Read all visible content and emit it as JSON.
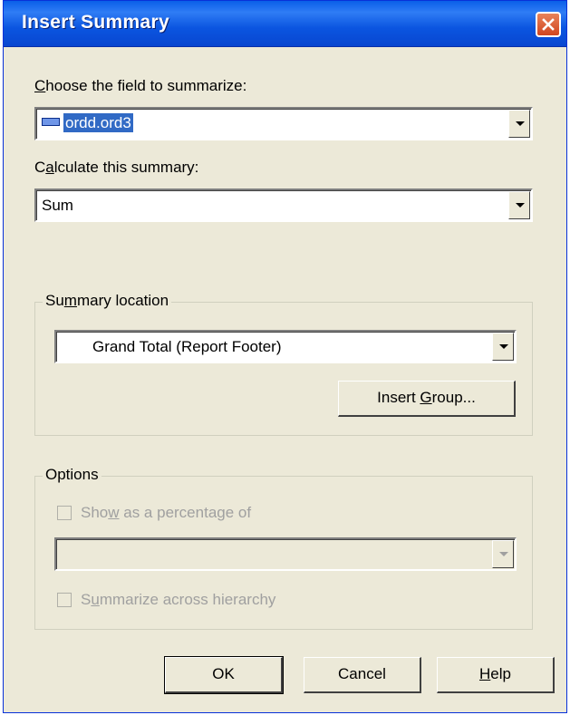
{
  "dialog": {
    "title": "Insert Summary",
    "icons": {
      "close": "close-x-icon",
      "field": "field-icon",
      "dropdown": "chevron-down-icon",
      "cursor": "mouse-cursor-icon"
    },
    "colors": {
      "titlebar": "#0a5fe8",
      "close": "#d1451f",
      "selection": "#316ac5",
      "face": "#ece9d8"
    }
  },
  "field": {
    "label_pre": "",
    "label_mnemonic": "C",
    "label_post": "hoose the field to summarize:",
    "value": "ordd.ord3"
  },
  "summary": {
    "label_pre": "C",
    "label_mnemonic": "a",
    "label_post": "lculate this summary:",
    "value": "Sum"
  },
  "location": {
    "legend_pre": "Su",
    "legend_mnemonic": "m",
    "legend_post": "mary location",
    "value": "Grand Total (Report Footer)",
    "insert_group_pre": "Insert ",
    "insert_group_mnemonic": "G",
    "insert_group_post": "roup..."
  },
  "options": {
    "legend": "Options",
    "show_pct_pre": "Sho",
    "show_pct_mnemonic": "w",
    "show_pct_post": " as a percentage of",
    "show_pct_checked": false,
    "percentage_of_value": "",
    "across_pre": "S",
    "across_mnemonic": "u",
    "across_post": "mmarize across hierarchy",
    "across_checked": false
  },
  "buttons": {
    "ok": "OK",
    "cancel": "Cancel",
    "help_mnemonic": "H",
    "help_post": "elp"
  }
}
